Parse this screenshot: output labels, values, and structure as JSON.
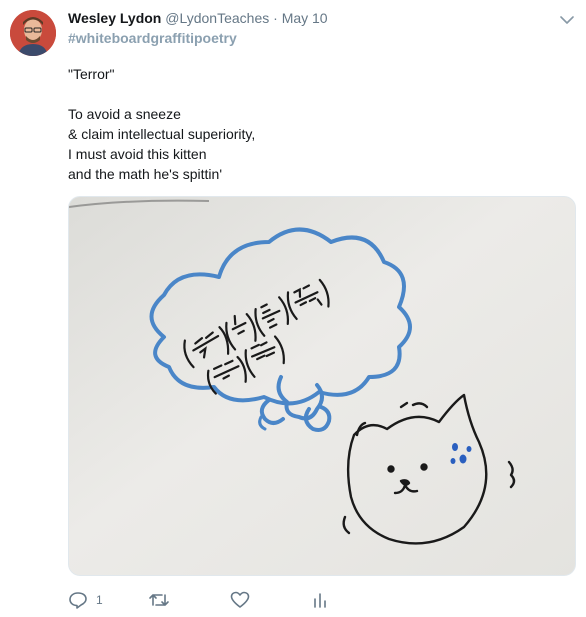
{
  "tweet": {
    "author_name": "Wesley Lydon",
    "author_handle": "@LydonTeaches",
    "separator": "·",
    "date": "May 10",
    "hashtag": "#whiteboardgraffitipoetry",
    "lines": [
      "\"Terror\"",
      "",
      "To avoid a sneeze",
      "& claim intellectual superiority,",
      "I must avoid this kitten",
      "and the math he's spittin'"
    ]
  },
  "actions": {
    "reply": {
      "icon": "reply-icon",
      "count": "1"
    },
    "retweet": {
      "icon": "retweet-icon",
      "count": ""
    },
    "like": {
      "icon": "heart-icon",
      "count": ""
    },
    "analytics": {
      "icon": "analytics-icon",
      "count": ""
    }
  },
  "colors": {
    "name": "#14171a",
    "meta": "#657786",
    "hashtag": "#8ba0b0",
    "marker_blue": "#4a86c8",
    "marker_black": "#1a1a1a"
  }
}
